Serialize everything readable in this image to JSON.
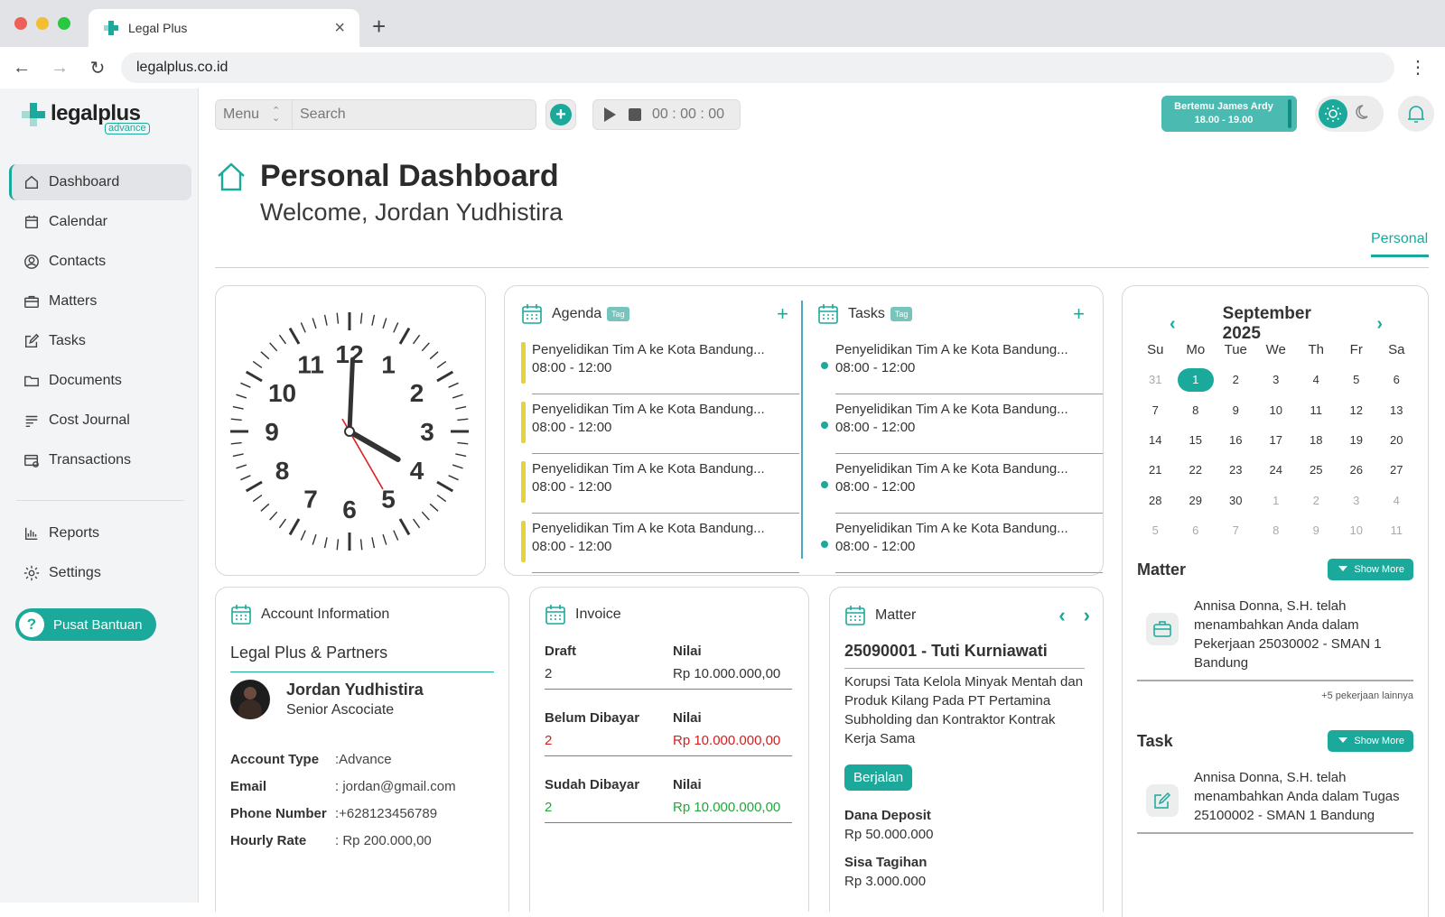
{
  "browser": {
    "tab_title": "Legal Plus",
    "url": "legalplus.co.id"
  },
  "logo": {
    "word": "legalplus",
    "sub": "advance"
  },
  "sidebar": {
    "items": [
      {
        "label": "Dashboard"
      },
      {
        "label": "Calendar"
      },
      {
        "label": "Contacts"
      },
      {
        "label": "Matters"
      },
      {
        "label": "Tasks"
      },
      {
        "label": "Documents"
      },
      {
        "label": "Cost Journal"
      },
      {
        "label": "Transactions"
      }
    ],
    "bottom": [
      {
        "label": "Reports"
      },
      {
        "label": "Settings"
      }
    ],
    "help": "Pusat Bantuan"
  },
  "topbar": {
    "menu": "Menu",
    "search_placeholder": "Search",
    "timer": "00 : 00 : 00",
    "meeting_line1": "Bertemu James Ardy",
    "meeting_line2": "18.00 - 19.00"
  },
  "page": {
    "title": "Personal Dashboard",
    "welcome": "Welcome, Jordan Yudhistira",
    "tab": "Personal"
  },
  "clock": {
    "hour": 4,
    "minute": 0,
    "second": 25
  },
  "agenda": {
    "title": "Agenda",
    "tag": "Tag",
    "items": [
      {
        "title": "Penyelidikan Tim A ke Kota Bandung...",
        "time": "08:00 - 12:00"
      },
      {
        "title": "Penyelidikan Tim A ke Kota Bandung...",
        "time": "08:00 - 12:00"
      },
      {
        "title": "Penyelidikan Tim A ke Kota Bandung...",
        "time": "08:00 - 12:00"
      },
      {
        "title": "Penyelidikan Tim A ke Kota Bandung...",
        "time": "08:00 - 12:00"
      }
    ]
  },
  "tasks": {
    "title": "Tasks",
    "tag": "Tag",
    "items": [
      {
        "title": "Penyelidikan Tim A ke Kota Bandung...",
        "time": "08:00 - 12:00"
      },
      {
        "title": "Penyelidikan Tim A ke Kota Bandung...",
        "time": "08:00 - 12:00"
      },
      {
        "title": "Penyelidikan Tim A ke Kota Bandung...",
        "time": "08:00 - 12:00"
      },
      {
        "title": "Penyelidikan Tim A ke Kota Bandung...",
        "time": "08:00 - 12:00"
      }
    ]
  },
  "calendar": {
    "month": "September 2025",
    "days": [
      "Su",
      "Mo",
      "Tue",
      "We",
      "Th",
      "Fr",
      "Sa"
    ],
    "weeks": [
      [
        "31",
        "1",
        "2",
        "3",
        "4",
        "5",
        "6"
      ],
      [
        "7",
        "8",
        "9",
        "10",
        "11",
        "12",
        "13"
      ],
      [
        "14",
        "15",
        "16",
        "17",
        "18",
        "19",
        "20"
      ],
      [
        "21",
        "22",
        "23",
        "24",
        "25",
        "26",
        "27"
      ],
      [
        "28",
        "29",
        "30",
        "1",
        "2",
        "3",
        "4"
      ],
      [
        "5",
        "6",
        "7",
        "8",
        "9",
        "10",
        "11"
      ]
    ],
    "selected": "1"
  },
  "matter_feed": {
    "title": "Matter",
    "show_more": "Show More",
    "text": "Annisa Donna, S.H. telah menambahkan Anda dalam Pekerjaan 25030002 - SMAN 1 Bandung",
    "more": "+5 pekerjaan lainnya"
  },
  "task_feed": {
    "title": "Task",
    "show_more": "Show More",
    "text": "Annisa Donna, S.H. telah menambahkan Anda dalam Tugas 25100002 - SMAN 1 Bandung"
  },
  "account": {
    "title": "Account Information",
    "firm": "Legal Plus & Partners",
    "name": "Jordan Yudhistira",
    "role": "Senior Ascociate",
    "rows": [
      {
        "k": "Account Type",
        "v": ":Advance"
      },
      {
        "k": "Email",
        "v": ": jordan@gmail.com"
      },
      {
        "k": "Phone Number",
        "v": ":+628123456789"
      },
      {
        "k": "Hourly Rate",
        "v": ":  Rp 200.000,00"
      }
    ]
  },
  "invoice": {
    "title": "Invoice",
    "rows": [
      {
        "label": "Draft",
        "nilai": "Nilai",
        "count": "2",
        "amount": "Rp 10.000.000,00",
        "color": "#333333"
      },
      {
        "label": "Belum Dibayar",
        "nilai": "Nilai",
        "count": "2",
        "amount": "Rp 10.000.000,00",
        "color": "#d02020"
      },
      {
        "label": "Sudah Dibayar",
        "nilai": "Nilai",
        "count": "2",
        "amount": "Rp 10.000.000,00",
        "color": "#22a83a"
      }
    ]
  },
  "matter": {
    "title": "Matter",
    "case": "25090001 - Tuti Kurniawati",
    "desc": "Korupsi Tata Kelola Minyak Mentah dan Produk Kilang Pada PT Pertamina Subholding dan Kontraktor Kontrak Kerja Sama",
    "status": "Berjalan",
    "deposit_label": "Dana Deposit",
    "deposit": "Rp 50.000.000",
    "due_label": "Sisa Tagihan",
    "due": "Rp 3.000.000"
  },
  "colors": {
    "accent": "#1aa99a",
    "agenda_bar": "#e5d33a"
  }
}
